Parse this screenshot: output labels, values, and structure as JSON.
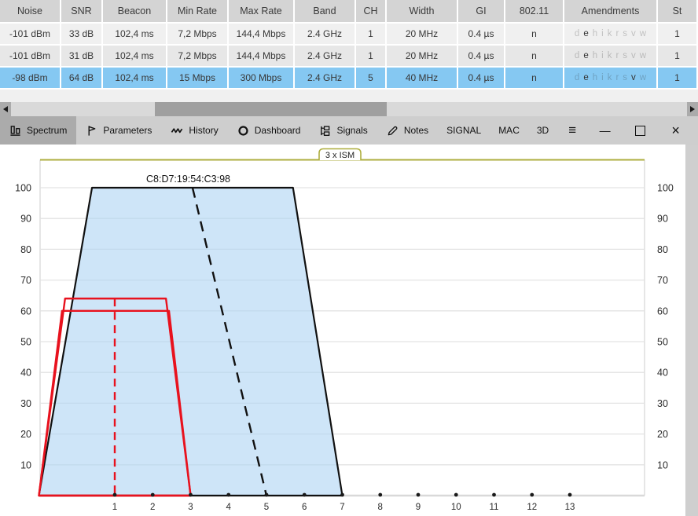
{
  "table": {
    "columns": [
      "Noise",
      "SNR",
      "Beacon",
      "Min Rate",
      "Max Rate",
      "Band",
      "CH",
      "Width",
      "GI",
      "802.11",
      "Amendments",
      "St"
    ],
    "amendment_letters": [
      "d",
      "e",
      "h",
      "i",
      "k",
      "r",
      "s",
      "v",
      "w"
    ],
    "rows": [
      {
        "selected": false,
        "cells": [
          "-101 dBm",
          "33 dB",
          "102,4 ms",
          "7,2 Mbps",
          "144,4 Mbps",
          "2.4 GHz",
          "1",
          "20 MHz",
          "0.4 µs",
          "n"
        ],
        "amendments_active": [
          "e"
        ],
        "st": "1"
      },
      {
        "selected": false,
        "cells": [
          "-101 dBm",
          "31 dB",
          "102,4 ms",
          "7,2 Mbps",
          "144,4 Mbps",
          "2.4 GHz",
          "1",
          "20 MHz",
          "0.4 µs",
          "n"
        ],
        "amendments_active": [
          "e"
        ],
        "st": "1"
      },
      {
        "selected": true,
        "cells": [
          "-98 dBm",
          "64 dB",
          "102,4 ms",
          "15 Mbps",
          "300 Mbps",
          "2.4 GHz",
          "5",
          "40 MHz",
          "0.4 µs",
          "n"
        ],
        "amendments_active": [
          "e",
          "v"
        ],
        "st": "1"
      }
    ],
    "selected_row_color": "#85c8f2"
  },
  "tabs": [
    {
      "label": "Spectrum",
      "icon": "spectrum-icon",
      "active": true
    },
    {
      "label": "Parameters",
      "icon": "flag-icon",
      "active": false
    },
    {
      "label": "History",
      "icon": "wave-icon",
      "active": false
    },
    {
      "label": "Dashboard",
      "icon": "circle-icon",
      "active": false
    },
    {
      "label": "Signals",
      "icon": "hierarchy-icon",
      "active": false
    },
    {
      "label": "Notes",
      "icon": "pencil-icon",
      "active": false
    },
    {
      "label": "SIGNAL",
      "icon": null,
      "active": false
    },
    {
      "label": "MAC",
      "icon": null,
      "active": false
    },
    {
      "label": "3D",
      "icon": null,
      "active": false
    }
  ],
  "menu_button": {
    "glyph": "≡"
  },
  "window_controls": [
    {
      "name": "minimize",
      "glyph": "—"
    },
    {
      "name": "maximize",
      "glyph": "□"
    },
    {
      "name": "close",
      "glyph": "×"
    }
  ],
  "chart": {
    "band_label": "3 x ISM",
    "band_line_color": "#aeae3f",
    "signal_label": "C8:D7:19:54:C3:98",
    "y_ticks": [
      100,
      90,
      80,
      70,
      60,
      50,
      40,
      30,
      20,
      10
    ],
    "channels": [
      1,
      2,
      3,
      4,
      5,
      6,
      7,
      8,
      9,
      10,
      11,
      12,
      13
    ],
    "signals": [
      {
        "name": "C8:D7:19:54:C3:98",
        "color": "#111111",
        "fill": "rgba(173,212,244,0.6)",
        "amplitude": 100,
        "base_ch": [
          -1,
          7
        ],
        "top_ch": [
          0.4,
          5.7
        ],
        "dash": {
          "ch1": 3.05,
          "v1": 100,
          "ch2": 5,
          "v2": 0
        }
      },
      {
        "name": "red-signal-64",
        "color": "#e8121e",
        "fill": "none",
        "amplitude": 64,
        "base_ch": [
          -1,
          3
        ],
        "top_ch": [
          -0.31,
          2.35
        ],
        "dash": {
          "ch1": 1,
          "v1": 64,
          "ch2": 1,
          "v2": 0
        }
      },
      {
        "name": "red-signal-60",
        "color": "#e8121e",
        "fill": "none",
        "amplitude": 60,
        "base_ch": [
          -1,
          3
        ],
        "top_ch": [
          -0.39,
          2.43
        ],
        "dash": null
      }
    ]
  }
}
